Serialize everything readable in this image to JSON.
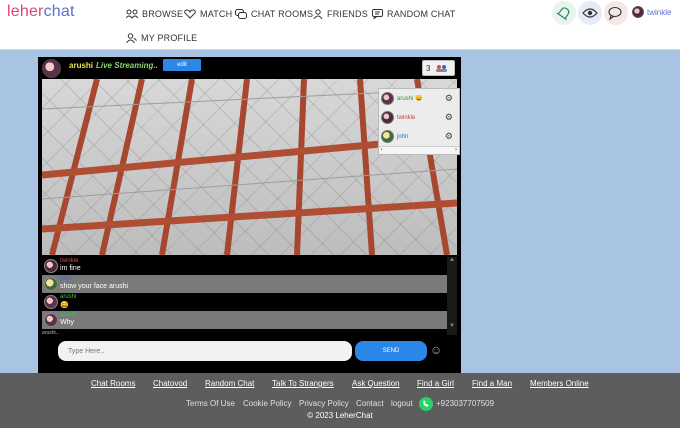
{
  "header": {
    "logo_part1": "leher",
    "logo_part2": "chat",
    "nav": {
      "browse": "BROWSE",
      "match": "MATCH",
      "chat_rooms": "CHAT ROOMS",
      "friends": "FRIENDS",
      "random_chat": "RANDOM CHAT",
      "my_profile": "MY PROFILE"
    },
    "username": "twinkle"
  },
  "stream": {
    "streamer_name": "arushi",
    "live_label": "Live Streaming..",
    "edit_label": "edit",
    "viewer_count": "3",
    "viewers": [
      {
        "name": "arushi",
        "color": "#2b9c2b"
      },
      {
        "name": "twinkle",
        "color": "#d23b3b"
      },
      {
        "name": "john",
        "color": "#3a63d6"
      }
    ]
  },
  "chat": {
    "messages": [
      {
        "name": "twinkle",
        "name_color": "#e04848",
        "text": "im fine",
        "bg": "black"
      },
      {
        "name": "john",
        "name_color": "#3a63d6",
        "text": "show your face arushi",
        "bg": "grey"
      },
      {
        "name": "arushi",
        "name_color": "#44c044",
        "text": "😄",
        "bg": "black"
      },
      {
        "name": "arushi",
        "name_color": "#44c044",
        "text": "Why",
        "bg": "grey"
      }
    ],
    "typing": "arushi..",
    "input_placeholder": "Type Here..",
    "send_label": "SEND"
  },
  "footer": {
    "links": [
      "Chat Rooms",
      "Chatovod",
      "Random Chat",
      "Talk To Strangers",
      "Ask Question",
      "Find a Girl",
      "Find a Man",
      "Members Online"
    ],
    "sub_links": [
      "Terms Of Use",
      "Cookie Policy",
      "Privacy Policy",
      "Contact",
      "logout"
    ],
    "phone": "+923037707509",
    "copyright": "© 2023 LeherChat"
  }
}
